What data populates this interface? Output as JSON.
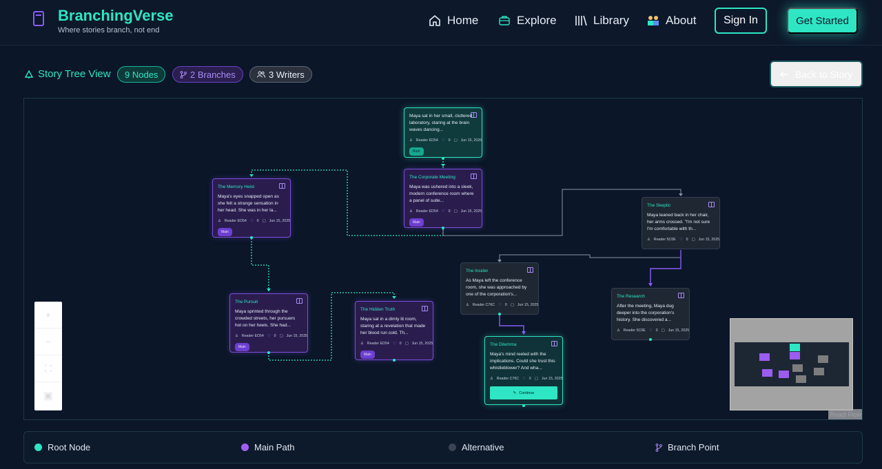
{
  "header": {
    "brand": "BranchingVerse",
    "tagline": "Where stories branch, not end",
    "nav": [
      {
        "label": "Home",
        "icon": "home-icon"
      },
      {
        "label": "Explore",
        "icon": "briefcase-icon"
      },
      {
        "label": "Library",
        "icon": "library-icon"
      },
      {
        "label": "About",
        "icon": "team-icon"
      }
    ],
    "sign_in": "Sign In",
    "get_started": "Get Started"
  },
  "subheader": {
    "title": "Story Tree View",
    "nodes": "9 Nodes",
    "branches": "2 Branches",
    "writers": "3 Writers",
    "back": "Back to Story"
  },
  "nodes": [
    {
      "title": "",
      "text": "Maya sat in her small, cluttered laboratory, staring at the brain waves dancing...",
      "author": "Reader ED54",
      "likes": "0",
      "date": "Jun 15, 2025",
      "tag": "Root"
    },
    {
      "title": "The Corporate Meeting",
      "text": "Maya was ushered into a sleek, modern conference room where a panel of suite...",
      "author": "Reader ED54",
      "likes": "0",
      "date": "Jun 15, 2025",
      "tag": "Main"
    },
    {
      "title": "The Memory Heist",
      "text": "Maya's eyes snapped open as she felt a strange sensation in her head. She was in her la...",
      "author": "Reader ED54",
      "likes": "0",
      "date": "Jun 15, 2025",
      "tag": "Main"
    },
    {
      "title": "The Pursuit",
      "text": "Maya sprinted through the crowded streets, her pursuers hot on her heels. She had...",
      "author": "Reader ED54",
      "likes": "0",
      "date": "Jun 15, 2025",
      "tag": "Main"
    },
    {
      "title": "The Hidden Truth",
      "text": "Maya sat in a dimly lit room, staring at a revelation that made her blood run cold. Th...",
      "author": "Reader ED54",
      "likes": "0",
      "date": "Jun 15, 2025",
      "tag": "Main"
    },
    {
      "title": "The Skeptic",
      "text": "Maya leaned back in her chair, her arms crossed. \"I'm not sure I'm comfortable with th...",
      "author": "Reader 5C0E",
      "likes": "0",
      "date": "Jun 15, 2025",
      "tag": ""
    },
    {
      "title": "The Insider",
      "text": "As Maya left the conference room, she was approached by one of the corporation's...",
      "author": "Reader C76C",
      "likes": "0",
      "date": "Jun 15, 2025",
      "tag": ""
    },
    {
      "title": "The Research",
      "text": "After the meeting, Maya dug deeper into the corporation's history. She discovered a...",
      "author": "Reader 5C0E",
      "likes": "0",
      "date": "Jun 15, 2025",
      "tag": ""
    },
    {
      "title": "The Dilemma",
      "text": "Maya's mind reeled with the implications. Could she trust this whistleblower? And wha...",
      "author": "Reader C76C",
      "likes": "0",
      "date": "Jun 15, 2025",
      "tag": ""
    }
  ],
  "continue_label": "Continue",
  "zoom": {
    "plus": "+",
    "minus": "−",
    "fit": "⛶",
    "lock": "▣"
  },
  "credit": "React Flow",
  "legend": {
    "root": "Root Node",
    "main": "Main Path",
    "alt": "Alternative",
    "branch": "Branch Point"
  },
  "colors": {
    "accent": "#2ee6c4",
    "main": "#8b5cf6",
    "alternative": "#3a4453",
    "background": "#0b1628"
  }
}
